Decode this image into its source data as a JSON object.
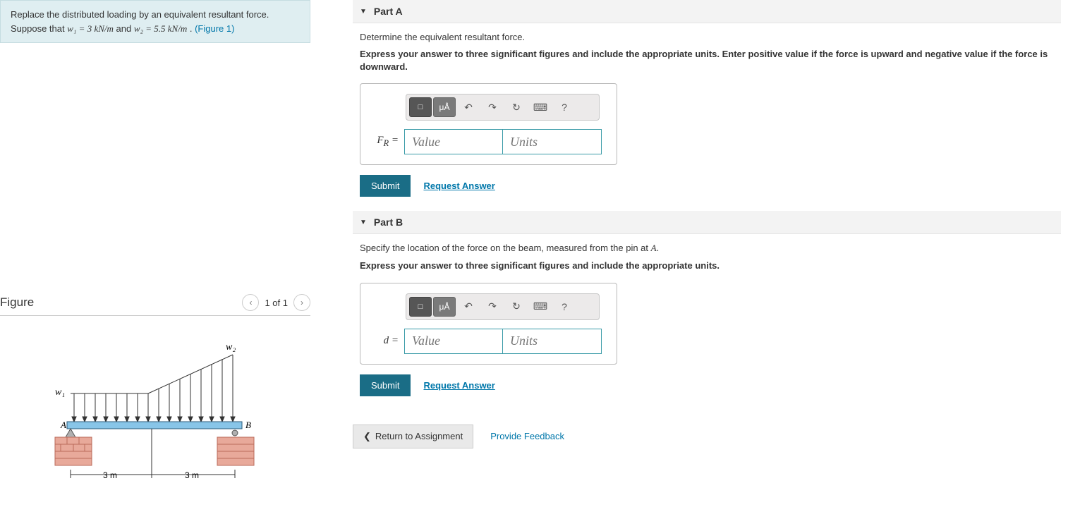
{
  "problem": {
    "line1": "Replace the distributed loading by an equivalent resultant force.",
    "line2_prefix": "Suppose that ",
    "w1_eq": "w₁ = 3 kN/m",
    "line2_mid": " and ",
    "w2_eq": "w₂ = 5.5 kN/m",
    "line2_suffix": " . ",
    "figure_link": "(Figure 1)"
  },
  "figure": {
    "title": "Figure",
    "nav_text": "1 of 1",
    "labels": {
      "w1": "w₁",
      "w2": "w₂",
      "A": "A",
      "B": "B",
      "dist1": "3 m",
      "dist2": "3 m"
    }
  },
  "parts": [
    {
      "title": "Part A",
      "instruction": "Determine the equivalent resultant force.",
      "bold": "Express your answer to three significant figures and include the appropriate units. Enter positive value if the force is upward and negative value if the force is downward.",
      "var_label": "F_R =",
      "value_placeholder": "Value",
      "units_placeholder": "Units",
      "submit": "Submit",
      "request": "Request Answer"
    },
    {
      "title": "Part B",
      "instruction_prefix": "Specify the location of the force on the beam, measured from the pin at ",
      "instruction_var": "A",
      "instruction_suffix": ".",
      "bold": "Express your answer to three significant figures and include the appropriate units.",
      "var_label": "d =",
      "value_placeholder": "Value",
      "units_placeholder": "Units",
      "submit": "Submit",
      "request": "Request Answer"
    }
  ],
  "toolbar": {
    "templates": "□",
    "units_btn": "μÅ",
    "undo": "↶",
    "redo": "↷",
    "reset": "↻",
    "keyboard": "⌨",
    "help": "?"
  },
  "footer": {
    "return": "Return to Assignment",
    "feedback": "Provide Feedback"
  }
}
